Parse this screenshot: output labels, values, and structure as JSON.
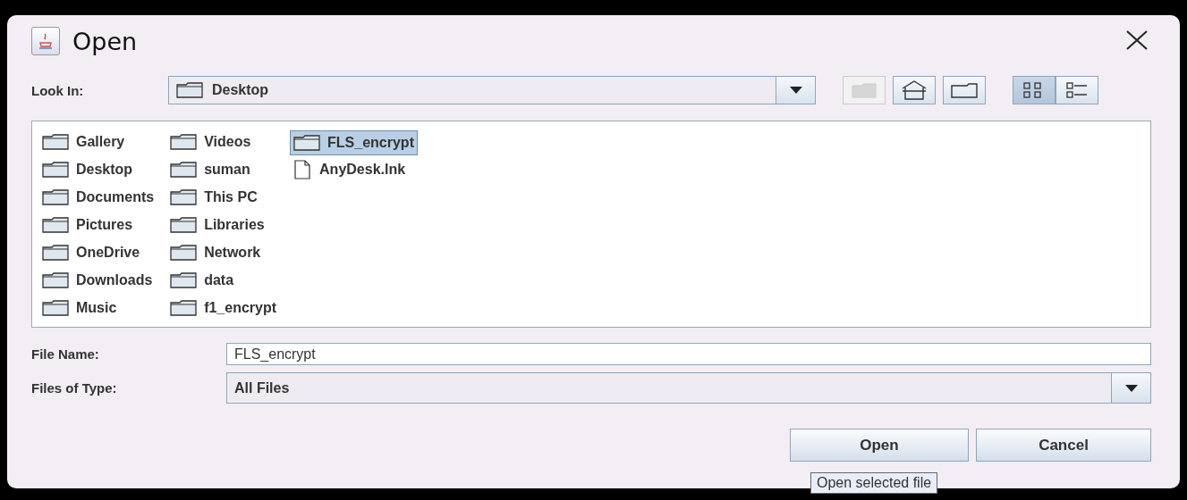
{
  "window": {
    "title": "Open"
  },
  "look_in": {
    "label": "Look In:",
    "value": "Desktop"
  },
  "toolbar": [
    {
      "kind": "up",
      "disabled": true,
      "selected": false
    },
    {
      "kind": "home",
      "disabled": false,
      "selected": false
    },
    {
      "kind": "new-folder",
      "disabled": false,
      "selected": false
    },
    {
      "kind": "list",
      "disabled": false,
      "selected": true
    },
    {
      "kind": "details",
      "disabled": false,
      "selected": false
    }
  ],
  "files": [
    {
      "name": "Gallery",
      "kind": "folder",
      "selected": false
    },
    {
      "name": "Desktop",
      "kind": "folder",
      "selected": false
    },
    {
      "name": "Documents",
      "kind": "folder",
      "selected": false
    },
    {
      "name": "Pictures",
      "kind": "folder",
      "selected": false
    },
    {
      "name": "OneDrive",
      "kind": "folder",
      "selected": false
    },
    {
      "name": "Downloads",
      "kind": "folder",
      "selected": false
    },
    {
      "name": "Music",
      "kind": "folder",
      "selected": false
    },
    {
      "name": "Videos",
      "kind": "folder",
      "selected": false
    },
    {
      "name": "suman",
      "kind": "folder",
      "selected": false
    },
    {
      "name": "This PC",
      "kind": "folder",
      "selected": false
    },
    {
      "name": "Libraries",
      "kind": "folder",
      "selected": false
    },
    {
      "name": "Network",
      "kind": "folder",
      "selected": false
    },
    {
      "name": "data",
      "kind": "folder",
      "selected": false
    },
    {
      "name": "f1_encrypt",
      "kind": "folder",
      "selected": false
    },
    {
      "name": "FLS_encrypt",
      "kind": "folder",
      "selected": true
    },
    {
      "name": "AnyDesk.lnk",
      "kind": "file",
      "selected": false
    }
  ],
  "file_name": {
    "label": "File Name:",
    "value": "FLS_encrypt"
  },
  "file_type": {
    "label": "Files of Type:",
    "value": "All Files"
  },
  "buttons": [
    {
      "label": "Open"
    },
    {
      "label": "Cancel"
    }
  ],
  "tooltip": "Open selected file"
}
